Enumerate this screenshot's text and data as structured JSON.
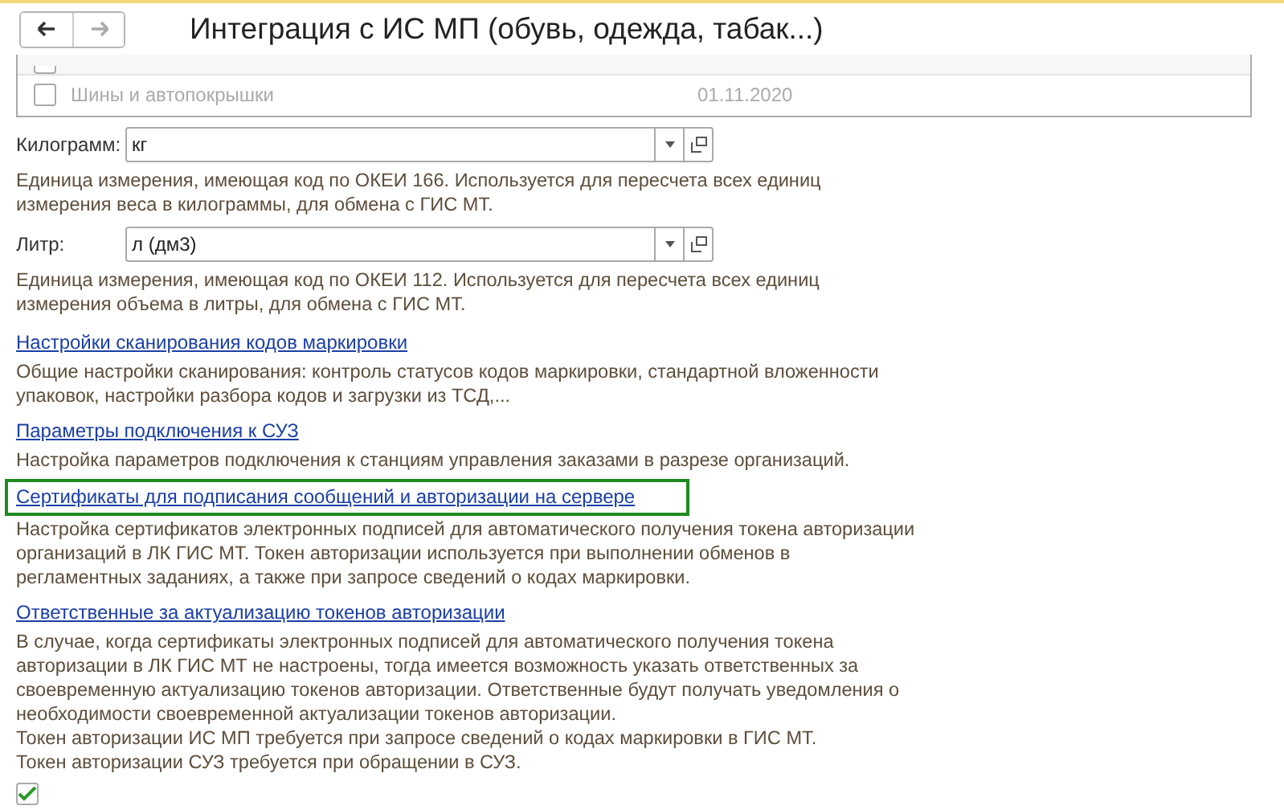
{
  "window": {
    "title": "Интеграция с ИС МП (обувь, одежда, табак...)"
  },
  "nav": {
    "back_disabled": false,
    "forward_disabled": true
  },
  "table": {
    "rows": [
      {
        "name": "Шины и автопокрышки",
        "date": "01.11.2020",
        "checked": false
      }
    ]
  },
  "fields": [
    {
      "label": "Килограмм:",
      "value": "кг",
      "description": "Единица измерения, имеющая код по ОКЕИ 166. Используется для пересчета всех единиц измерения веса в килограммы, для обмена с ГИС МТ."
    },
    {
      "label": "Литр:",
      "value": "л (дм3)",
      "description": "Единица измерения, имеющая код по ОКЕИ 112. Используется для пересчета всех единиц измерения объема в литры, для обмена с ГИС МТ."
    }
  ],
  "sections": [
    {
      "link": "Настройки сканирования кодов маркировки",
      "highlighted": false,
      "description": [
        "Общие настройки сканирования: контроль статусов кодов маркировки, стандартной вложенности упаковок, настройки разбора кодов и загрузки из ТСД,..."
      ]
    },
    {
      "link": "Параметры подключения к СУЗ",
      "highlighted": false,
      "description": [
        "Настройка параметров подключения к станциям управления заказами в разрезе организаций."
      ]
    },
    {
      "link": "Сертификаты для подписания сообщений и авторизации на сервере",
      "highlighted": true,
      "description": [
        "Настройка сертификатов электронных подписей для автоматического получения токена авторизации организаций в ЛК ГИС МТ. Токен авторизации используется при выполнении обменов в регламентных заданиях, а также при запросе сведений о кодах маркировки."
      ]
    },
    {
      "link": "Ответственные за актуализацию токенов авторизации",
      "highlighted": false,
      "description": [
        "В случае, когда сертификаты электронных подписей для автоматического получения токена авторизации в ЛК ГИС МТ не настроены, тогда имеется возможность указать ответственных за своевременную актуализацию токенов авторизации. Ответственные будут получать уведомления о необходимости своевременной актуализации токенов авторизации.",
        "Токен авторизации ИС МП требуется при запросе сведений о кодах маркировки в ГИС МТ.",
        "Токен авторизации СУЗ требуется при обращении в СУЗ."
      ]
    }
  ],
  "bottom_checkbox": {
    "checked": true
  }
}
